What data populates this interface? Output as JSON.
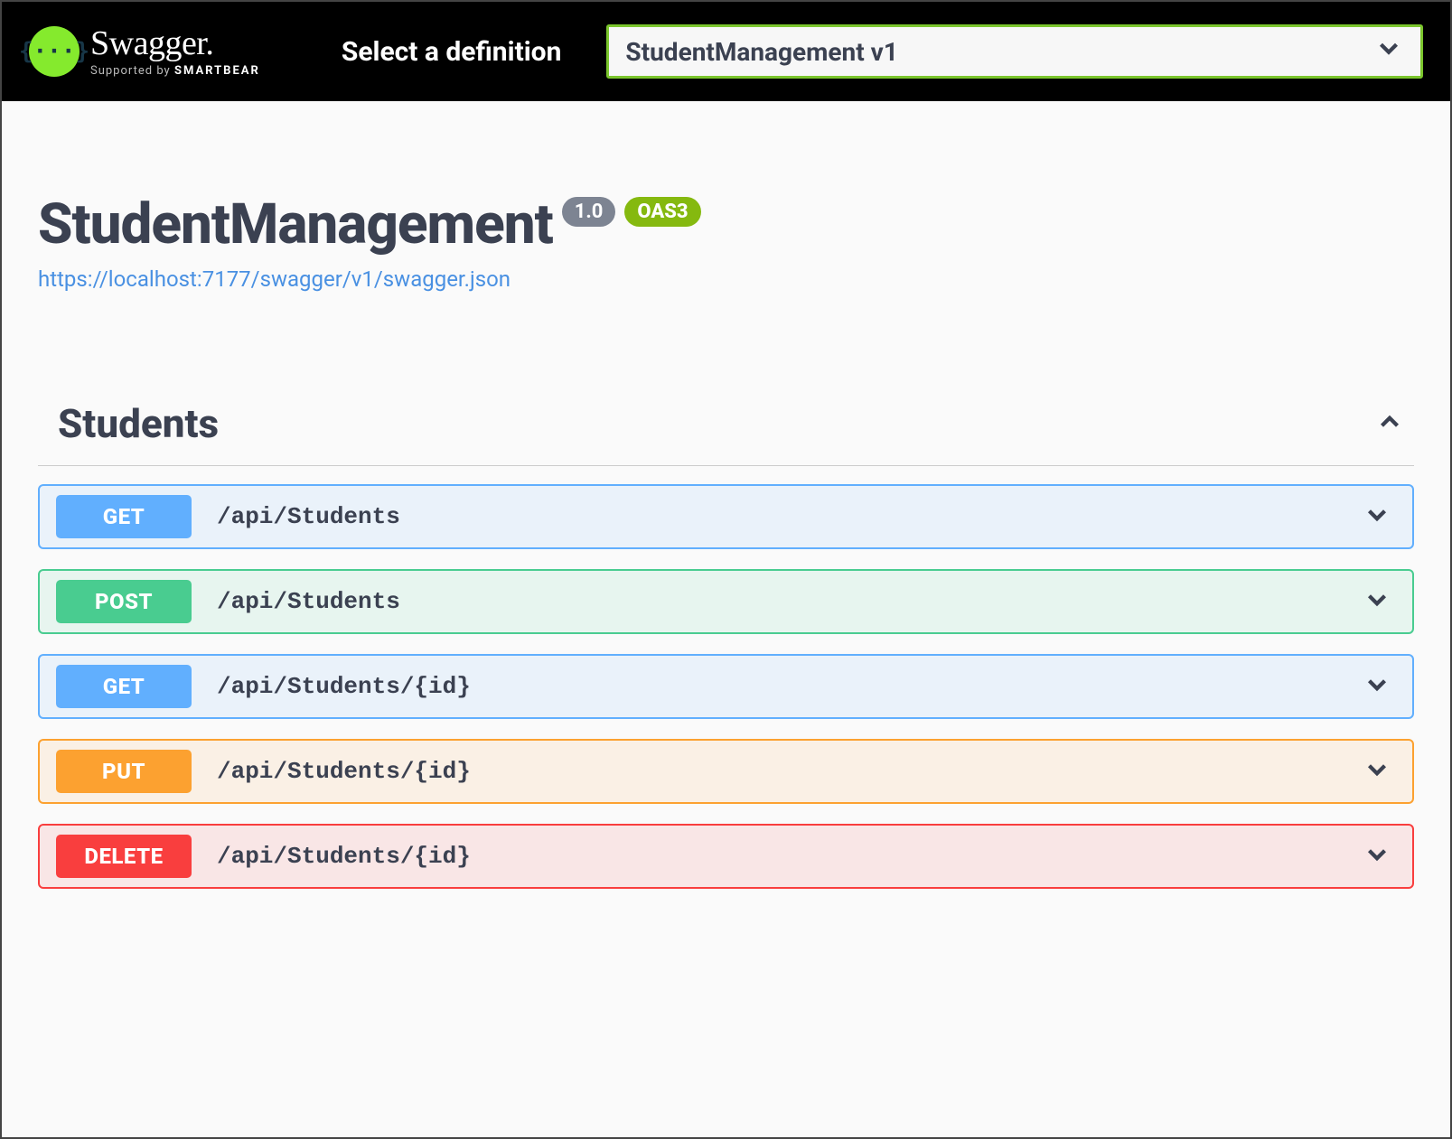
{
  "topbar": {
    "logo_text": "Swagger.",
    "supported_prefix": "Supported by ",
    "supported_brand": "SMARTBEAR",
    "select_label": "Select a definition",
    "definition_selected": "StudentManagement v1"
  },
  "info": {
    "title": "StudentManagement",
    "version": "1.0",
    "oas_label": "OAS3",
    "spec_url": "https://localhost:7177/swagger/v1/swagger.json"
  },
  "tag": {
    "name": "Students",
    "operations": [
      {
        "method": "GET",
        "path": "/api/Students",
        "class": "op-get"
      },
      {
        "method": "POST",
        "path": "/api/Students",
        "class": "op-post"
      },
      {
        "method": "GET",
        "path": "/api/Students/{id}",
        "class": "op-get"
      },
      {
        "method": "PUT",
        "path": "/api/Students/{id}",
        "class": "op-put"
      },
      {
        "method": "DELETE",
        "path": "/api/Students/{id}",
        "class": "op-delete"
      }
    ]
  }
}
